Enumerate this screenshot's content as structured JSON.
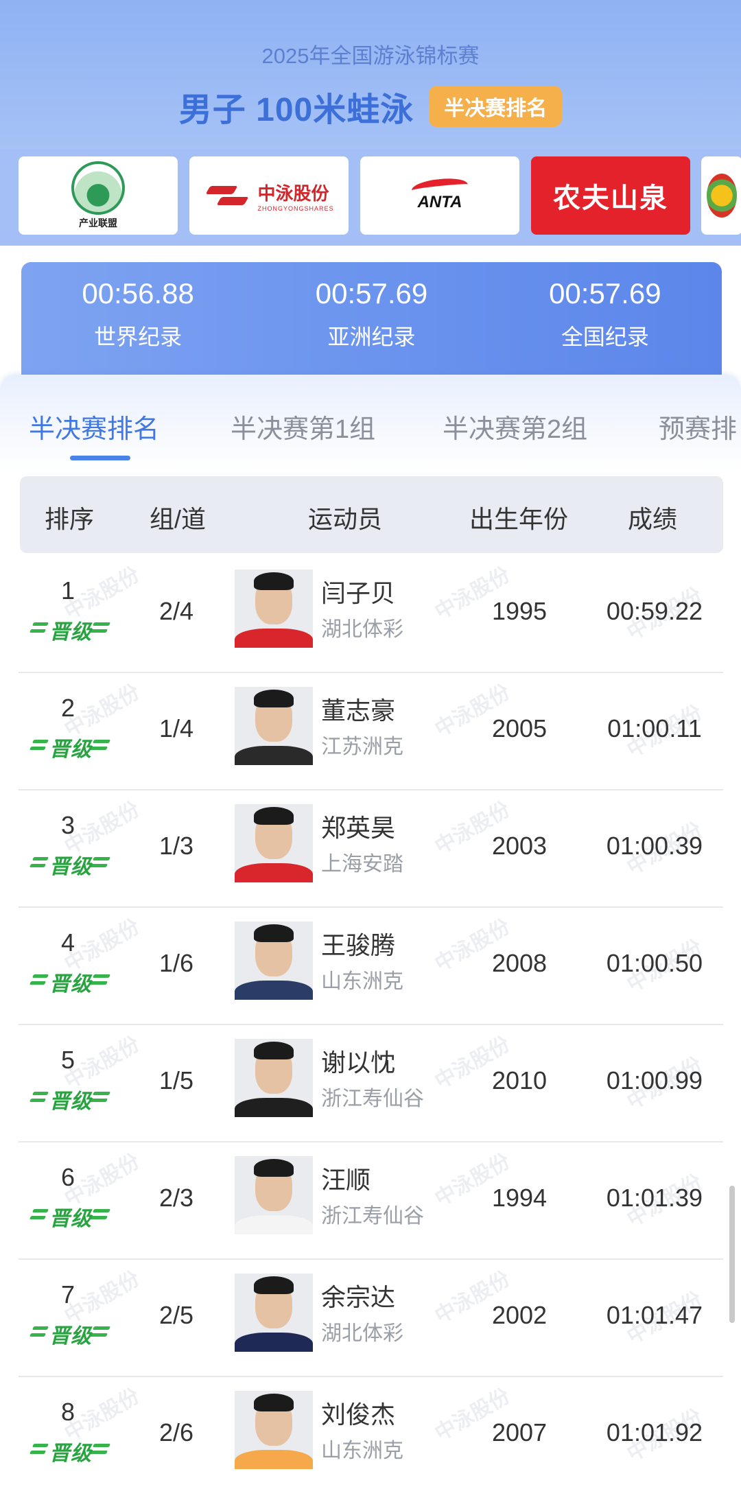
{
  "header": {
    "subtitle": "2025年全国游泳锦标赛",
    "title": "男子 100米蛙泳",
    "badge": "半决赛排名"
  },
  "sponsors": [
    {
      "name": "产业联盟",
      "icon": "alliance-logo"
    },
    {
      "name": "中泳股份",
      "name_en": "ZHONGYONGSHARES",
      "icon": "zhongyong-logo"
    },
    {
      "name": "ANTA",
      "icon": "anta-logo"
    },
    {
      "name": "农夫山泉",
      "icon": "nongfu-logo"
    }
  ],
  "records": [
    {
      "value": "00:56.88",
      "label": "世界纪录"
    },
    {
      "value": "00:57.69",
      "label": "亚洲纪录"
    },
    {
      "value": "00:57.69",
      "label": "全国纪录"
    }
  ],
  "tabs": [
    "半决赛排名",
    "半决赛第1组",
    "半决赛第2组",
    "预赛排"
  ],
  "table": {
    "headers": [
      "排序",
      "组/道",
      "运动员",
      "出生年份",
      "成绩"
    ],
    "qualified_label": "晋级",
    "watermark": "中泳股份",
    "rows": [
      {
        "rank": "1",
        "lane": "2/4",
        "name": "闫子贝",
        "team": "湖北体彩",
        "year": "1995",
        "score": "00:59.22",
        "shirt": "#d8262c"
      },
      {
        "rank": "2",
        "lane": "1/4",
        "name": "董志豪",
        "team": "江苏洲克",
        "year": "2005",
        "score": "01:00.11",
        "shirt": "#2a2a2a"
      },
      {
        "rank": "3",
        "lane": "1/3",
        "name": "郑英昊",
        "team": "上海安踏",
        "year": "2003",
        "score": "01:00.39",
        "shirt": "#d8262c"
      },
      {
        "rank": "4",
        "lane": "1/6",
        "name": "王骏腾",
        "team": "山东洲克",
        "year": "2008",
        "score": "01:00.50",
        "shirt": "#2b3d66"
      },
      {
        "rank": "5",
        "lane": "1/5",
        "name": "谢以忱",
        "team": "浙江寿仙谷",
        "year": "2010",
        "score": "01:00.99",
        "shirt": "#1f1f1f"
      },
      {
        "rank": "6",
        "lane": "2/3",
        "name": "汪顺",
        "team": "浙江寿仙谷",
        "year": "1994",
        "score": "01:01.39",
        "shirt": "#f4f4f4"
      },
      {
        "rank": "7",
        "lane": "2/5",
        "name": "余宗达",
        "team": "湖北体彩",
        "year": "2002",
        "score": "01:01.47",
        "shirt": "#1e2a55"
      },
      {
        "rank": "8",
        "lane": "2/6",
        "name": "刘俊杰",
        "team": "山东洲克",
        "year": "2007",
        "score": "01:01.92",
        "shirt": "#f6a94a"
      }
    ]
  },
  "colors": {
    "accent": "#3f78e3",
    "qualified": "#27a33f",
    "badge": "#f5b04c"
  }
}
